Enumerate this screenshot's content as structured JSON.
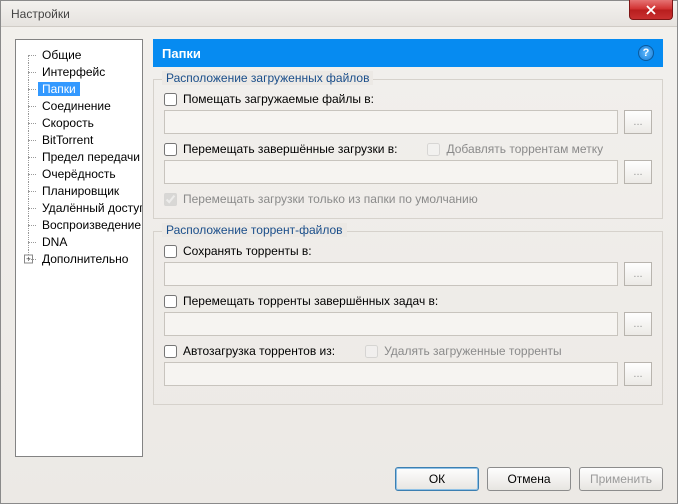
{
  "window": {
    "title": "Настройки"
  },
  "tree": {
    "items": [
      {
        "label": "Общие"
      },
      {
        "label": "Интерфейс"
      },
      {
        "label": "Папки",
        "selected": true
      },
      {
        "label": "Соединение"
      },
      {
        "label": "Скорость"
      },
      {
        "label": "BitTorrent"
      },
      {
        "label": "Предел передачи"
      },
      {
        "label": "Очерёдность"
      },
      {
        "label": "Планировщик"
      },
      {
        "label": "Удалённый доступ"
      },
      {
        "label": "Воспроизведение"
      },
      {
        "label": "DNA"
      },
      {
        "label": "Дополнительно",
        "expandable": true
      }
    ]
  },
  "pane": {
    "title": "Папки"
  },
  "group1": {
    "title": "Расположение загруженных файлов",
    "put_label": "Помещать загружаемые файлы в:",
    "move_label": "Перемещать завершённые загрузки в:",
    "addlabel_label": "Добавлять торрентам метку",
    "onlydefault_label": "Перемещать загрузки только из папки по умолчанию"
  },
  "group2": {
    "title": "Расположение торрент-файлов",
    "save_label": "Сохранять торренты в:",
    "movefin_label": "Перемещать торренты завершённых задач в:",
    "autoload_label": "Автозагрузка торрентов из:",
    "delete_label": "Удалять загруженные торренты"
  },
  "browse_label": "...",
  "footer": {
    "ok": "ОК",
    "cancel": "Отмена",
    "apply": "Применить"
  },
  "help_char": "?"
}
